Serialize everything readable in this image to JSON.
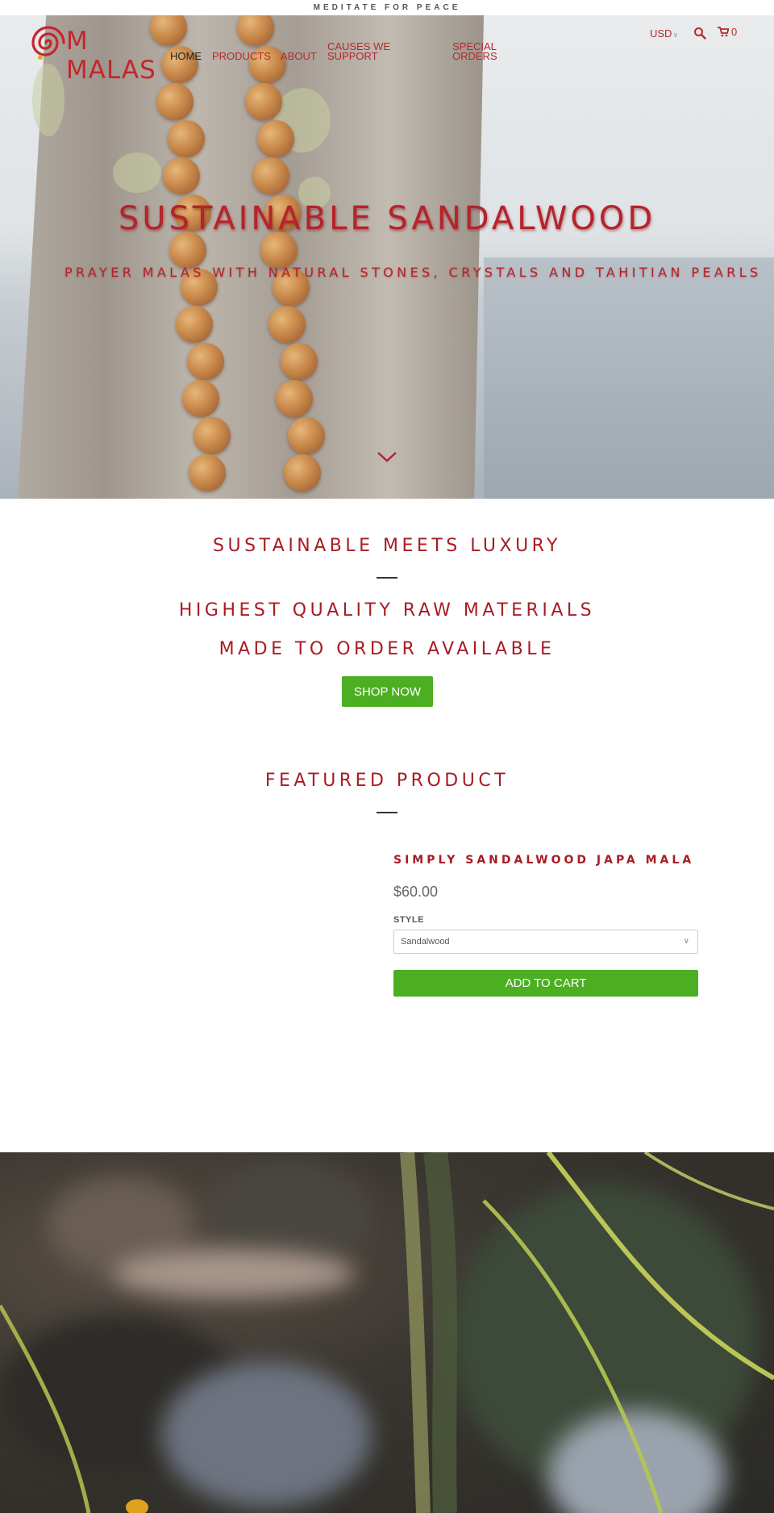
{
  "announcement": "MEDITATE FOR PEACE",
  "brand": {
    "logo_text": "M MALAS"
  },
  "nav": {
    "items": [
      {
        "label": "HOME",
        "active": true
      },
      {
        "label": "PRODUCTS",
        "active": false
      },
      {
        "label": "ABOUT",
        "active": false
      },
      {
        "label": "CAUSES WE SUPPORT",
        "active": false
      },
      {
        "label": "SPECIAL ORDERS",
        "active": false
      }
    ]
  },
  "header": {
    "currency": "USD",
    "cart_count": "0"
  },
  "hero": {
    "title": "SUSTAINABLE SANDALWOOD",
    "subtitle": "PRAYER MALAS WITH NATURAL STONES, CRYSTALS AND TAHITIAN PEARLS"
  },
  "promo": {
    "heading": "SUSTAINABLE MEETS LUXURY",
    "line1": "HIGHEST QUALITY RAW MATERIALS",
    "line2": "MADE TO ORDER AVAILABLE",
    "button": "SHOP NOW"
  },
  "featured": {
    "heading": "FEATURED PRODUCT",
    "product_title": "SIMPLY SANDALWOOD JAPA MALA",
    "price": "$60.00",
    "style_label": "STYLE",
    "style_value": "Sandalwood",
    "add_to_cart": "ADD TO CART"
  },
  "colors": {
    "brand_red": "#b5232b",
    "button_green": "#4caf22"
  },
  "icons": [
    "logo-swirl-icon",
    "search-icon",
    "cart-icon",
    "chevron-down-icon"
  ]
}
